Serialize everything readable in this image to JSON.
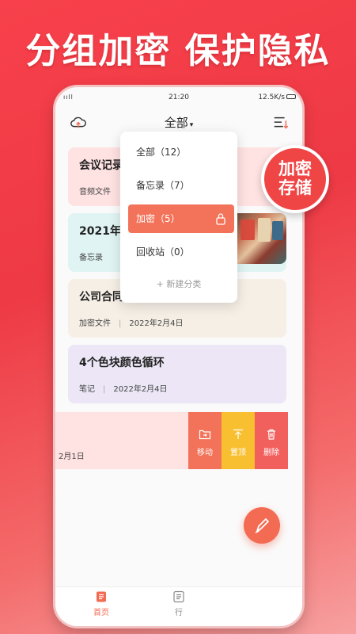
{
  "promo": {
    "headline": "分组加密 保护隐私",
    "badge_line1": "加密",
    "badge_line2": "存储"
  },
  "statusbar": {
    "signal": "ııll",
    "time": "21:20",
    "speed": "12.5K/s"
  },
  "topbar": {
    "title": "全部",
    "caret": "▾"
  },
  "notes": [
    {
      "title": "会议记录",
      "category": "音频文件",
      "date": ""
    },
    {
      "title": "2021年终",
      "category": "备忘录",
      "date": ""
    },
    {
      "title": "公司合同",
      "category": "加密文件",
      "date": "2022年2月4日"
    },
    {
      "title": "4个色块颜色循环",
      "category": "笔记",
      "date": "2022年2月4日"
    }
  ],
  "swipe_row": {
    "partial_date": "2月1日",
    "actions": [
      "移动",
      "置顶",
      "删除"
    ]
  },
  "dropdown": {
    "items": [
      {
        "label": "全部（12）"
      },
      {
        "label": "备忘录（7）"
      },
      {
        "label": "加密（5）"
      },
      {
        "label": "回收站（0）"
      }
    ],
    "new_category": "+ 新建分类"
  },
  "bottombar": {
    "tabs": [
      "首页",
      "行"
    ]
  },
  "colors": {
    "accent": "#f26b52",
    "pin": "#f8bf31",
    "delete": "#f2605e",
    "badge": "#f04545"
  }
}
